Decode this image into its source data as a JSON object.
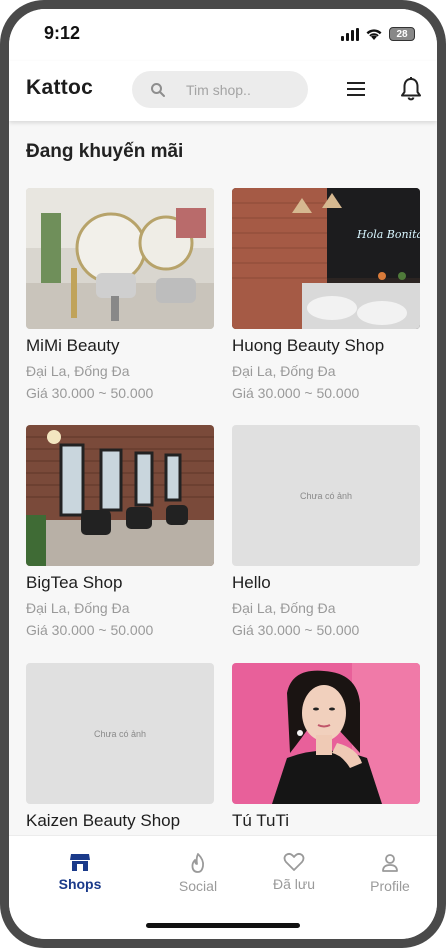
{
  "status": {
    "time": "9:12",
    "battery": "28"
  },
  "header": {
    "brand": "Kattoc",
    "search_placeholder": "Tim shop.."
  },
  "section_title": "Đang khuyến mãi",
  "shops": [
    {
      "name": "MiMi Beauty",
      "location": "Đại La, Đống Đa",
      "price": "Giá 30.000 ~ 50.000",
      "image": "salon-round-mirrors"
    },
    {
      "name": "Huong Beauty Shop",
      "location": "Đại La, Đống Đa",
      "price": "Giá 30.000 ~ 50.000",
      "image": "salon-brick-wash"
    },
    {
      "name": "BigTea Shop",
      "location": "Đại La, Đống Đa",
      "price": "Giá 30.000 ~ 50.000",
      "image": "salon-brick-chairs"
    },
    {
      "name": "Hello",
      "location": "Đại La, Đống Đa",
      "price": "Giá 30.000 ~ 50.000",
      "image": "none",
      "no_image_text": "Chưa có ảnh"
    },
    {
      "name": "Kaizen Beauty Shop",
      "location": "",
      "price": "",
      "image": "none",
      "no_image_text": "Chưa có ảnh"
    },
    {
      "name": "Tú TuTi",
      "location": "",
      "price": "",
      "image": "portrait"
    }
  ],
  "nav": [
    {
      "label": "Shops",
      "icon": "store-icon",
      "active": true
    },
    {
      "label": "Social",
      "icon": "flame-icon",
      "active": false
    },
    {
      "label": "Đã lưu",
      "icon": "heart-icon",
      "active": false
    },
    {
      "label": "Profile",
      "icon": "person-icon",
      "active": false
    }
  ],
  "colors": {
    "accent": "#1a3a8a",
    "inactive": "#9a9a9a",
    "placeholder_bg": "#e0e0e0"
  }
}
